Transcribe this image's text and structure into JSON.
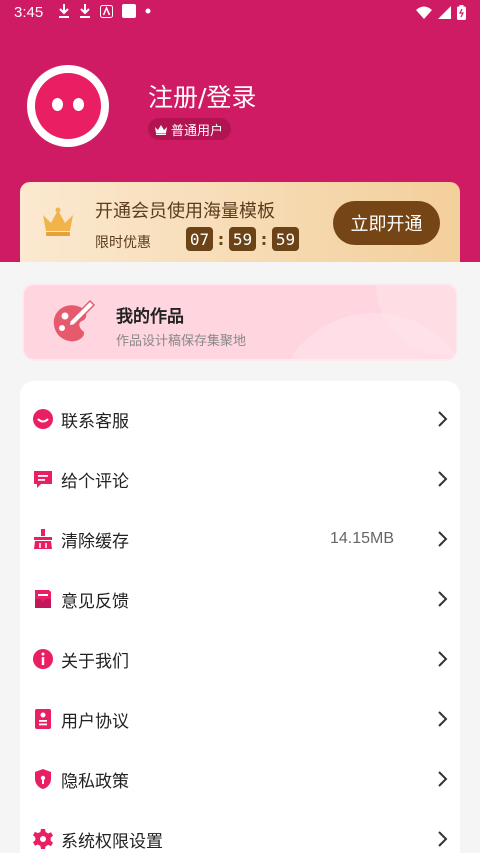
{
  "status_bar": {
    "time": "3:45"
  },
  "profile": {
    "login_label": "注册/登录",
    "user_type": "普通用户"
  },
  "vip": {
    "title": "开通会员使用海量模板",
    "limited_label": "限时优惠",
    "countdown": {
      "hours": "07",
      "minutes": "59",
      "seconds": "59"
    },
    "button_label": "立即开通"
  },
  "works": {
    "title": "我的作品",
    "subtitle": "作品设计稿保存集聚地"
  },
  "menu": {
    "items": [
      {
        "label": "联系客服",
        "icon": "chat-icon"
      },
      {
        "label": "给个评论",
        "icon": "comment-icon"
      },
      {
        "label": "清除缓存",
        "icon": "broom-icon",
        "value": "14.15MB"
      },
      {
        "label": "意见反馈",
        "icon": "feedback-icon"
      },
      {
        "label": "关于我们",
        "icon": "info-icon"
      },
      {
        "label": "用户协议",
        "icon": "document-icon"
      },
      {
        "label": "隐私政策",
        "icon": "shield-icon"
      },
      {
        "label": "系统权限设置",
        "icon": "gear-icon"
      }
    ]
  },
  "colors": {
    "brand": "#cf1b63",
    "accent_icon": "#e91e63",
    "vip_button": "#754516"
  }
}
